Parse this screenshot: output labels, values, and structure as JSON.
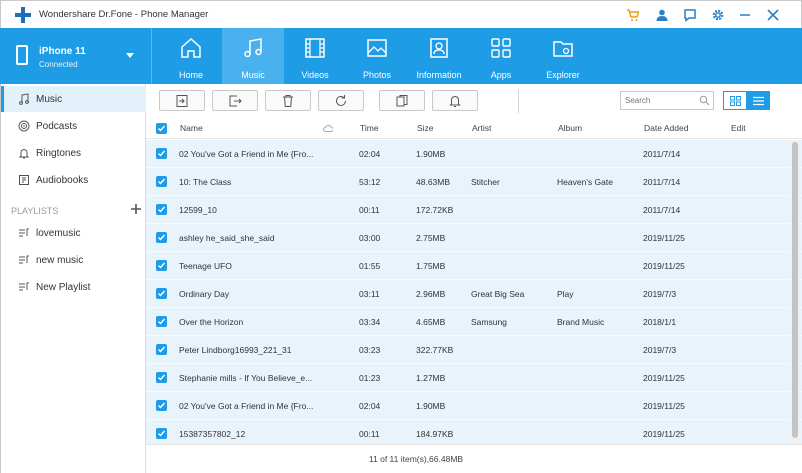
{
  "app": {
    "title": "Wondershare Dr.Fone - Phone Manager",
    "brand_color": "#1f9ce6"
  },
  "titlebar_icons": [
    "cart-icon",
    "user-icon",
    "feedback-icon",
    "settings-icon",
    "minimize-icon",
    "close-icon"
  ],
  "device": {
    "name": "iPhone 11",
    "status": "Connected"
  },
  "nav": {
    "tabs": [
      {
        "label": "Home",
        "icon": "home-icon"
      },
      {
        "label": "Music",
        "icon": "music-icon",
        "active": true
      },
      {
        "label": "Videos",
        "icon": "film-icon"
      },
      {
        "label": "Photos",
        "icon": "photo-icon"
      },
      {
        "label": "Information",
        "icon": "contact-card-icon"
      },
      {
        "label": "Apps",
        "icon": "apps-grid-icon"
      },
      {
        "label": "Explorer",
        "icon": "folder-gear-icon"
      }
    ]
  },
  "sidebar": {
    "items": [
      {
        "label": "Music",
        "icon": "music-note-icon",
        "active": true
      },
      {
        "label": "Podcasts",
        "icon": "podcast-icon"
      },
      {
        "label": "Ringtones",
        "icon": "bell-icon"
      },
      {
        "label": "Audiobooks",
        "icon": "audiobook-icon"
      }
    ],
    "playlists_heading": "PLAYLISTS",
    "playlists": [
      {
        "label": "lovemusic",
        "icon": "playlist-icon"
      },
      {
        "label": "new music",
        "icon": "playlist-icon"
      },
      {
        "label": "New Playlist",
        "icon": "playlist-icon"
      }
    ]
  },
  "toolbar": {
    "buttons": [
      "import-icon",
      "export-icon",
      "trash-icon",
      "refresh-icon",
      "dedupe-icon",
      "ringtone-maker-icon"
    ],
    "search_placeholder": "Search",
    "view_modes": [
      "grid-view-icon",
      "list-view-icon"
    ]
  },
  "table": {
    "headers": {
      "name": "Name",
      "time": "Time",
      "size": "Size",
      "artist": "Artist",
      "album": "Album",
      "date_added": "Date Added",
      "edit": "Edit"
    },
    "rows": [
      {
        "name": "02 You've Got a Friend in Me {Fro...",
        "time": "02:04",
        "size": "1.90MB",
        "artist": "",
        "album": "",
        "date": "2011/7/14",
        "checked": true
      },
      {
        "name": "10: The Class",
        "time": "53:12",
        "size": "48.63MB",
        "artist": "Stitcher",
        "album": "Heaven's Gate",
        "date": "2011/7/14",
        "checked": true
      },
      {
        "name": "12599_10",
        "time": "00:11",
        "size": "172.72KB",
        "artist": "",
        "album": "",
        "date": "2011/7/14",
        "checked": true
      },
      {
        "name": "ashley he_said_she_said",
        "time": "03:00",
        "size": "2.75MB",
        "artist": "",
        "album": "",
        "date": "2019/11/25",
        "checked": true
      },
      {
        "name": "Teenage UFO",
        "time": "01:55",
        "size": "1.75MB",
        "artist": "",
        "album": "",
        "date": "2019/11/25",
        "checked": true
      },
      {
        "name": "Ordinary Day",
        "time": "03:11",
        "size": "2.96MB",
        "artist": "Great Big Sea",
        "album": "Play",
        "date": "2019/7/3",
        "checked": true
      },
      {
        "name": "Over the Horizon",
        "time": "03:34",
        "size": "4.65MB",
        "artist": "Samsung",
        "album": "Brand Music",
        "date": "2018/1/1",
        "checked": true
      },
      {
        "name": "Peter Lindborg16993_221_31",
        "time": "03:23",
        "size": "322.77KB",
        "artist": "",
        "album": "",
        "date": "2019/7/3",
        "checked": true
      },
      {
        "name": "Stephanie mills - If You Believe_e...",
        "time": "01:23",
        "size": "1.27MB",
        "artist": "",
        "album": "",
        "date": "2019/11/25",
        "checked": true
      },
      {
        "name": "02 You've Got a Friend in Me {Fro...",
        "time": "02:04",
        "size": "1.90MB",
        "artist": "",
        "album": "",
        "date": "2019/11/25",
        "checked": true
      },
      {
        "name": "15387357802_12",
        "time": "00:11",
        "size": "184.97KB",
        "artist": "",
        "album": "",
        "date": "2019/11/25",
        "checked": true
      }
    ]
  },
  "footer": {
    "summary": "11 of 11 item(s),66.48MB"
  }
}
